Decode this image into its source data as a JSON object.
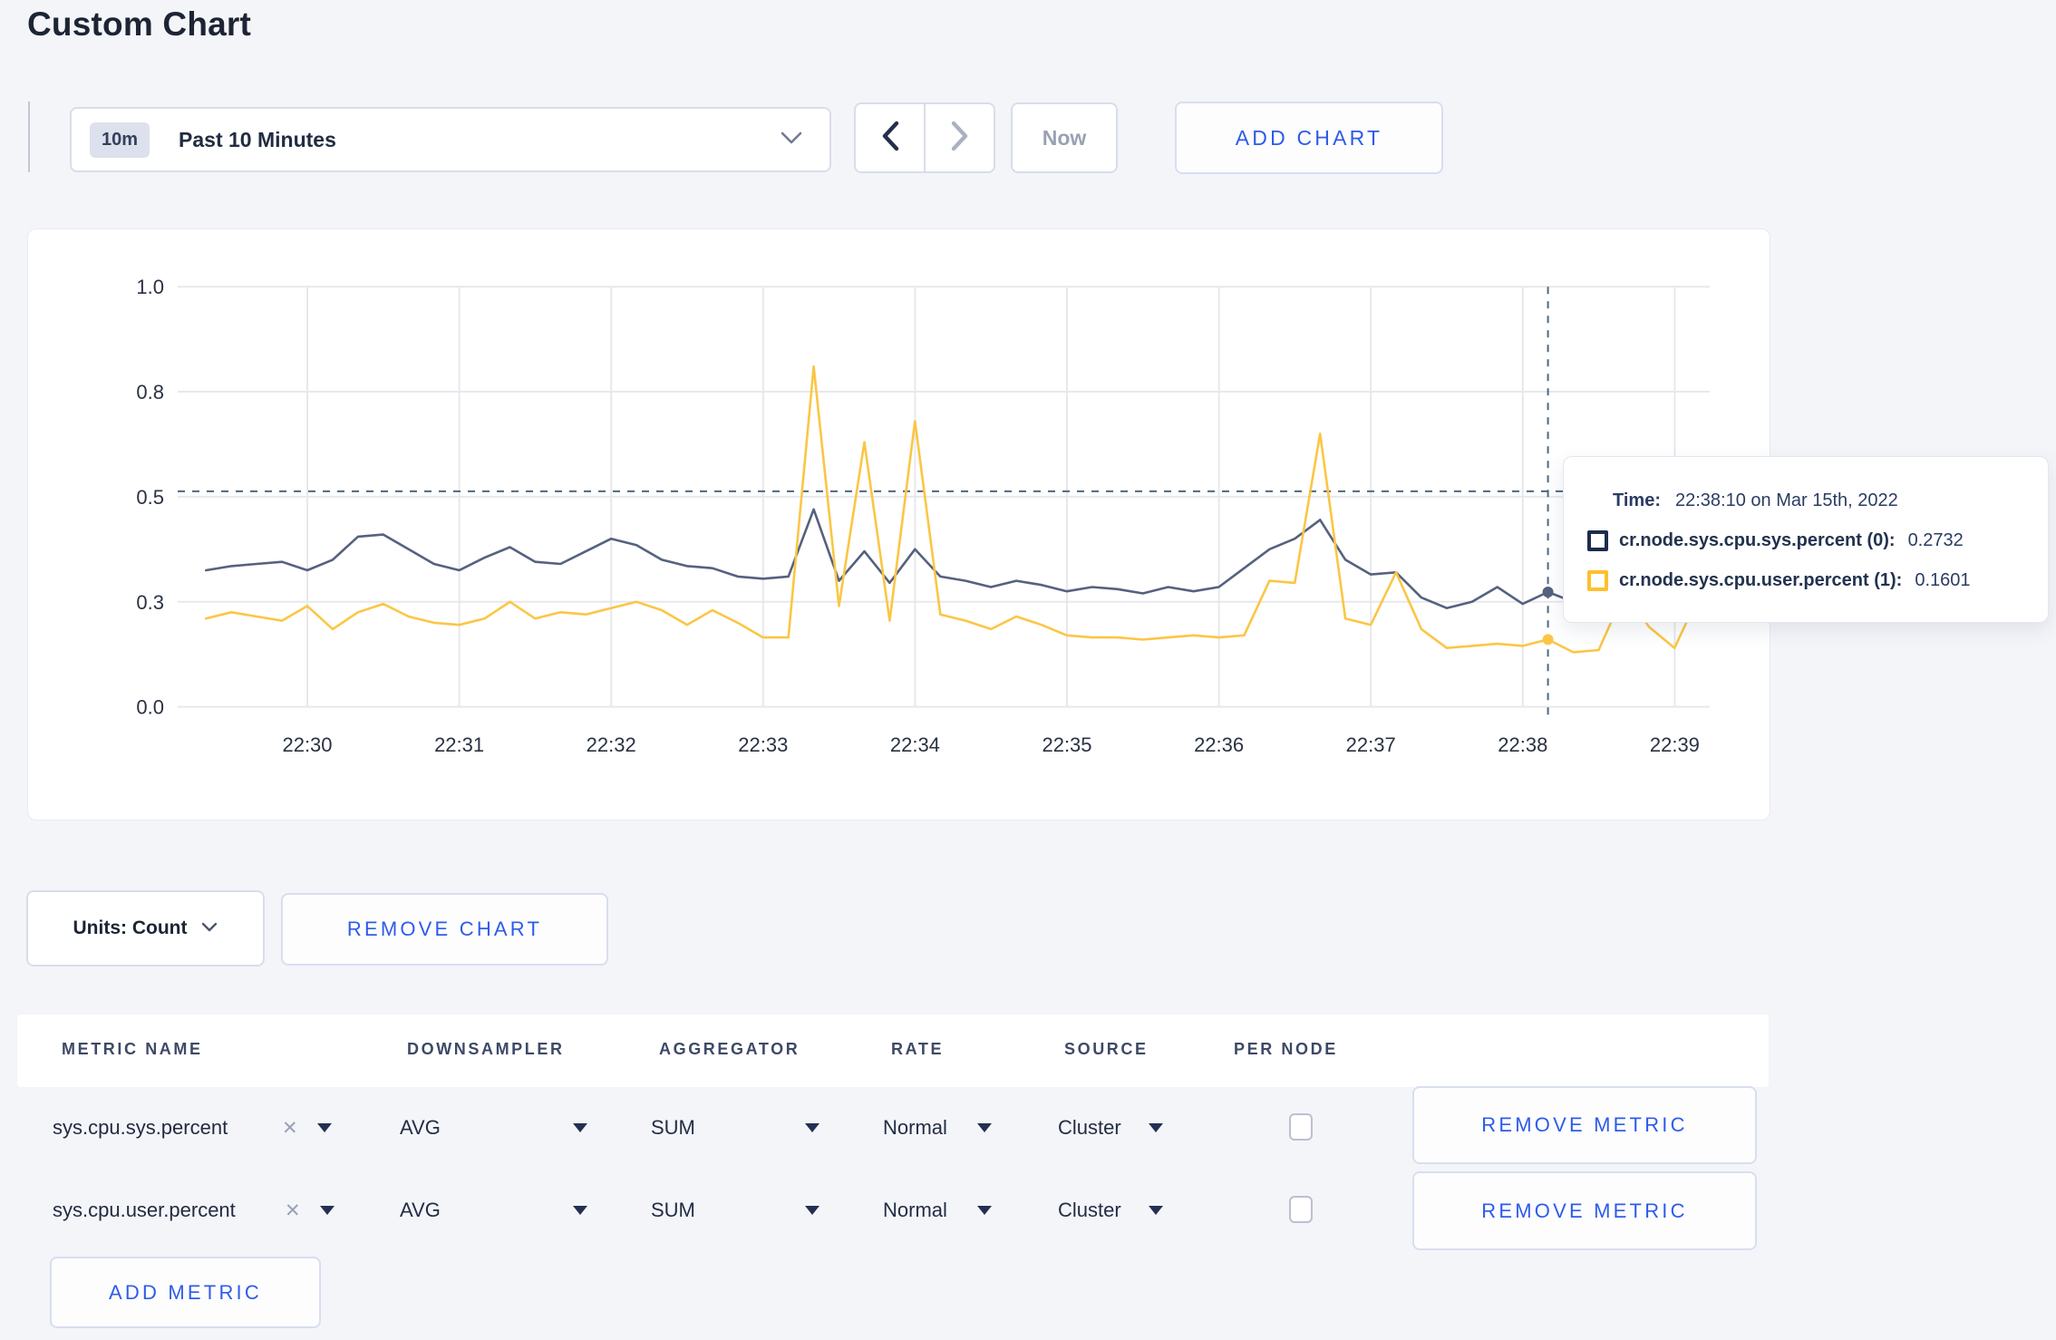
{
  "page": {
    "title": "Custom Chart"
  },
  "colors": {
    "accent_blue": "#2e5bea",
    "series_sys_line": "#55617e",
    "series_user_line": "#fbc645",
    "gridline": "#e7e8ec",
    "crosshair": "#4f6880"
  },
  "toolbar": {
    "range_badge": "10m",
    "range_label": "Past 10 Minutes",
    "now_label": "Now",
    "add_chart_label": "ADD CHART"
  },
  "chart": {
    "tooltip": {
      "time_label": "Time:",
      "time_value": "22:38:10 on Mar 15th, 2022",
      "series": [
        {
          "name": "cr.node.sys.cpu.sys.percent (0):",
          "value": "0.2732",
          "color": "#1d2c4e"
        },
        {
          "name": "cr.node.sys.cpu.user.percent (1):",
          "value": "0.1601",
          "color": "#fdc02e"
        }
      ]
    }
  },
  "chart_data": {
    "type": "line",
    "title": "",
    "xlabel": "",
    "ylabel": "",
    "ylim": [
      0,
      1
    ],
    "grid": true,
    "legend_position": "tooltip",
    "y_ticks": {
      "values": [
        0,
        0.25,
        0.5,
        0.75,
        1.0
      ],
      "labels": [
        "0.0",
        "0.3",
        "0.5",
        "0.8",
        "1.0"
      ]
    },
    "x_ticks": [
      "22:30",
      "22:31",
      "22:32",
      "22:33",
      "22:34",
      "22:35",
      "22:36",
      "22:37",
      "22:38",
      "22:39"
    ],
    "x": [
      "22:29:20",
      "22:29:30",
      "22:29:40",
      "22:29:50",
      "22:30:00",
      "22:30:10",
      "22:30:20",
      "22:30:30",
      "22:30:40",
      "22:30:50",
      "22:31:00",
      "22:31:10",
      "22:31:20",
      "22:31:30",
      "22:31:40",
      "22:31:50",
      "22:32:00",
      "22:32:10",
      "22:32:20",
      "22:32:30",
      "22:32:40",
      "22:32:50",
      "22:33:00",
      "22:33:10",
      "22:33:20",
      "22:33:30",
      "22:33:40",
      "22:33:50",
      "22:34:00",
      "22:34:10",
      "22:34:20",
      "22:34:30",
      "22:34:40",
      "22:34:50",
      "22:35:00",
      "22:35:10",
      "22:35:20",
      "22:35:30",
      "22:35:40",
      "22:35:50",
      "22:36:00",
      "22:36:10",
      "22:36:20",
      "22:36:30",
      "22:36:40",
      "22:36:50",
      "22:37:00",
      "22:37:10",
      "22:37:20",
      "22:37:30",
      "22:37:40",
      "22:37:50",
      "22:38:00",
      "22:38:10",
      "22:38:20",
      "22:38:30",
      "22:38:40",
      "22:38:50",
      "22:39:00",
      "22:39:10"
    ],
    "series": [
      {
        "name": "cr.node.sys.cpu.sys.percent",
        "color": "#55617e",
        "values": [
          0.325,
          0.335,
          0.34,
          0.345,
          0.325,
          0.35,
          0.405,
          0.41,
          0.375,
          0.34,
          0.325,
          0.355,
          0.38,
          0.345,
          0.34,
          0.37,
          0.4,
          0.385,
          0.35,
          0.335,
          0.33,
          0.31,
          0.305,
          0.31,
          0.47,
          0.3,
          0.37,
          0.295,
          0.375,
          0.31,
          0.3,
          0.285,
          0.3,
          0.29,
          0.275,
          0.285,
          0.28,
          0.27,
          0.285,
          0.275,
          0.285,
          0.33,
          0.375,
          0.4,
          0.445,
          0.35,
          0.315,
          0.32,
          0.26,
          0.235,
          0.25,
          0.285,
          0.245,
          0.2732,
          0.25,
          0.26,
          0.28,
          0.275,
          0.29,
          0.305
        ]
      },
      {
        "name": "cr.node.sys.cpu.user.percent",
        "color": "#fbc645",
        "values": [
          0.21,
          0.225,
          0.215,
          0.205,
          0.24,
          0.185,
          0.225,
          0.245,
          0.215,
          0.2,
          0.195,
          0.21,
          0.25,
          0.21,
          0.225,
          0.22,
          0.235,
          0.25,
          0.23,
          0.195,
          0.23,
          0.2,
          0.165,
          0.165,
          0.81,
          0.24,
          0.63,
          0.205,
          0.68,
          0.22,
          0.205,
          0.185,
          0.215,
          0.195,
          0.17,
          0.165,
          0.165,
          0.16,
          0.165,
          0.17,
          0.165,
          0.17,
          0.3,
          0.295,
          0.65,
          0.21,
          0.195,
          0.32,
          0.185,
          0.14,
          0.145,
          0.15,
          0.145,
          0.1601,
          0.13,
          0.135,
          0.27,
          0.19,
          0.14,
          0.27
        ]
      }
    ],
    "hover": {
      "x_index": 53,
      "time": "22:38:10",
      "crosshair_value": 0.513
    }
  },
  "units_row": {
    "units_label": "Units: Count",
    "remove_chart_label": "REMOVE CHART"
  },
  "metrics_table": {
    "headers": [
      "METRIC NAME",
      "DOWNSAMPLER",
      "AGGREGATOR",
      "RATE",
      "SOURCE",
      "PER NODE"
    ],
    "rows": [
      {
        "metric": "sys.cpu.sys.percent",
        "downsampler": "AVG",
        "aggregator": "SUM",
        "rate": "Normal",
        "source": "Cluster",
        "per_node": false,
        "remove_label": "REMOVE METRIC"
      },
      {
        "metric": "sys.cpu.user.percent",
        "downsampler": "AVG",
        "aggregator": "SUM",
        "rate": "Normal",
        "source": "Cluster",
        "per_node": false,
        "remove_label": "REMOVE METRIC"
      }
    ],
    "add_metric_label": "ADD METRIC"
  }
}
